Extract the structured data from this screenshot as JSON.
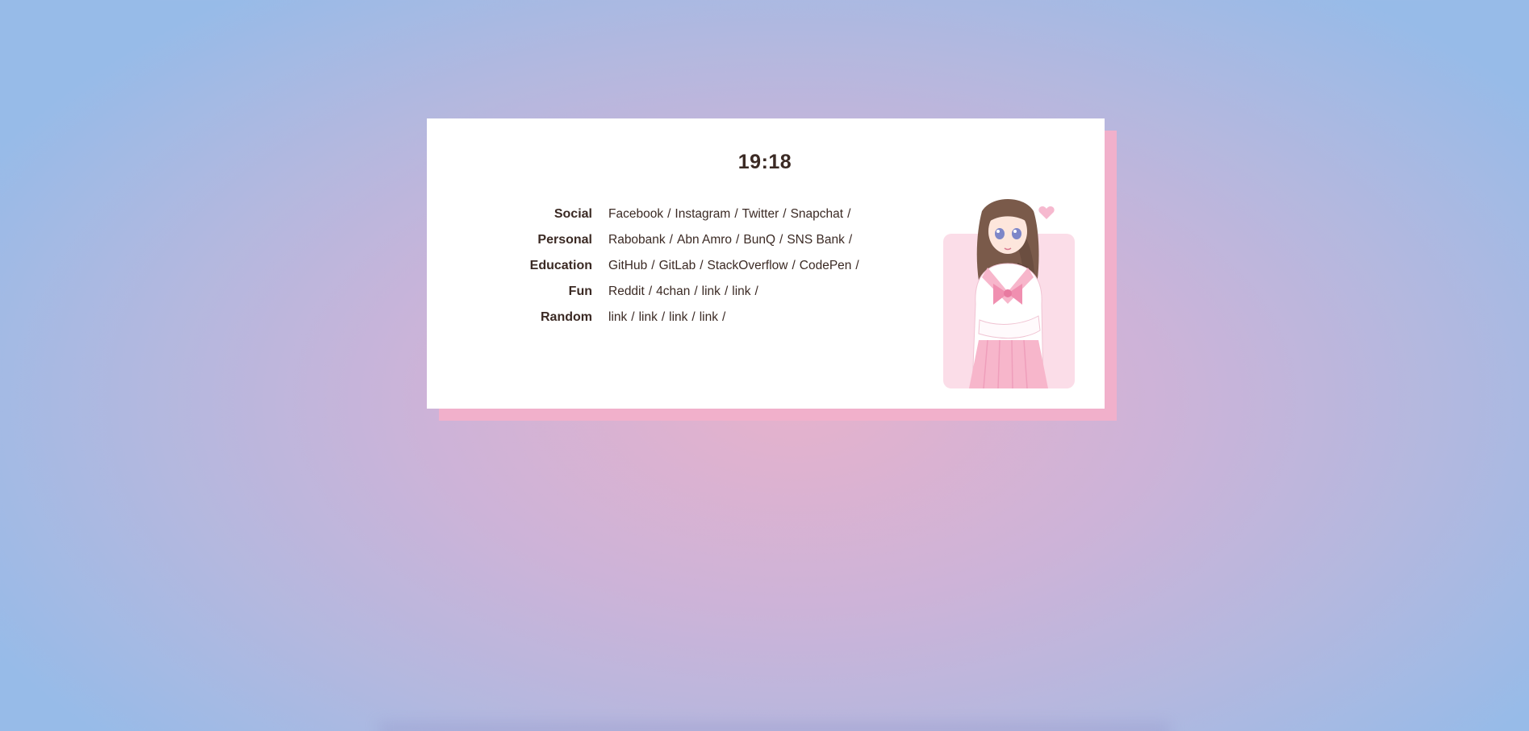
{
  "clock": {
    "time": "19:18"
  },
  "categories": [
    {
      "label": "Social",
      "links": [
        "Facebook",
        "Instagram",
        "Twitter",
        "Snapchat"
      ]
    },
    {
      "label": "Personal",
      "links": [
        "Rabobank",
        "Abn Amro",
        "BunQ",
        "SNS Bank"
      ]
    },
    {
      "label": "Education",
      "links": [
        "GitHub",
        "GitLab",
        "StackOverflow",
        "CodePen"
      ]
    },
    {
      "label": "Fun",
      "links": [
        "Reddit",
        "4chan",
        "link",
        "link"
      ]
    },
    {
      "label": "Random",
      "links": [
        "link",
        "link",
        "link",
        "link"
      ]
    }
  ],
  "separator": "/",
  "illustration": {
    "icon": "anime-girl-illustration",
    "colors": {
      "pink": "#f7c6d6",
      "hair": "#7a5a4a"
    }
  },
  "colors": {
    "accent_shadow": "#f1b0cb",
    "text": "#3b2a24",
    "card": "#ffffff"
  }
}
